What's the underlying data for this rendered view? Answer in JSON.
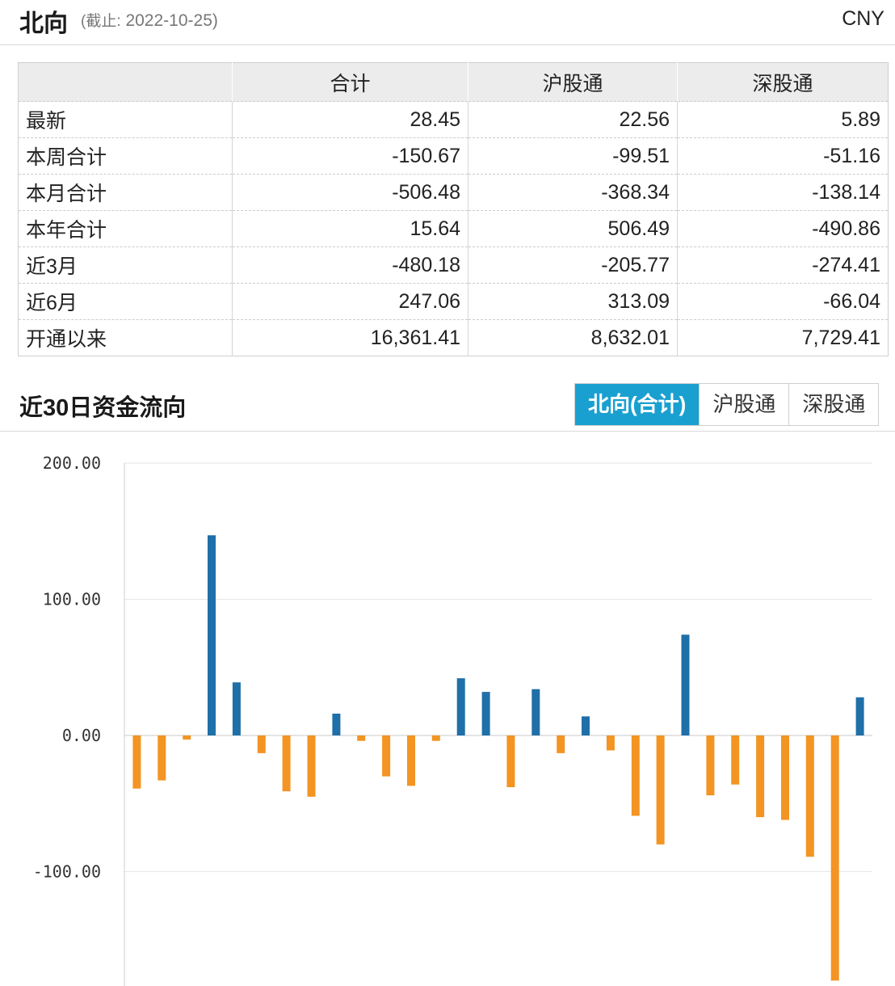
{
  "header": {
    "title": "北向",
    "asof_label": "(截止:",
    "asof_date": "2022-10-25)",
    "currency": "CNY"
  },
  "summary_table": {
    "columns": [
      "",
      "合计",
      "沪股通",
      "深股通"
    ],
    "rows": [
      {
        "label": "最新",
        "total": "28.45",
        "sh": "22.56",
        "sz": "5.89"
      },
      {
        "label": "本周合计",
        "total": "-150.67",
        "sh": "-99.51",
        "sz": "-51.16"
      },
      {
        "label": "本月合计",
        "total": "-506.48",
        "sh": "-368.34",
        "sz": "-138.14"
      },
      {
        "label": "本年合计",
        "total": "15.64",
        "sh": "506.49",
        "sz": "-490.86"
      },
      {
        "label": "近3月",
        "total": "-480.18",
        "sh": "-205.77",
        "sz": "-274.41"
      },
      {
        "label": "近6月",
        "total": "247.06",
        "sh": "313.09",
        "sz": "-66.04"
      },
      {
        "label": "开通以来",
        "total": "16,361.41",
        "sh": "8,632.01",
        "sz": "7,729.41"
      }
    ]
  },
  "section": {
    "title": "近30日资金流向",
    "tabs": [
      {
        "label": "北向(合计)",
        "active": true
      },
      {
        "label": "沪股通",
        "active": false
      },
      {
        "label": "深股通",
        "active": false
      }
    ]
  },
  "colors": {
    "positive": "#1f6fa8",
    "negative": "#f39423",
    "tab_active": "#1aa0d0"
  },
  "chart_data": {
    "type": "bar",
    "ylim": [
      -180,
      200
    ],
    "yticks": [
      200,
      100,
      0,
      -100
    ],
    "ytick_labels": [
      "200.00",
      "100.00",
      "0.00",
      "-100.00"
    ],
    "grid": true,
    "values": [
      -39,
      -33,
      -3,
      147,
      39,
      -13,
      -41,
      -45,
      16,
      -4,
      -30,
      -37,
      -4,
      42,
      32,
      -38,
      34,
      -13,
      14,
      -11,
      -59,
      -80,
      74,
      -44,
      -36,
      -60,
      -62,
      -89,
      -180,
      28
    ]
  }
}
